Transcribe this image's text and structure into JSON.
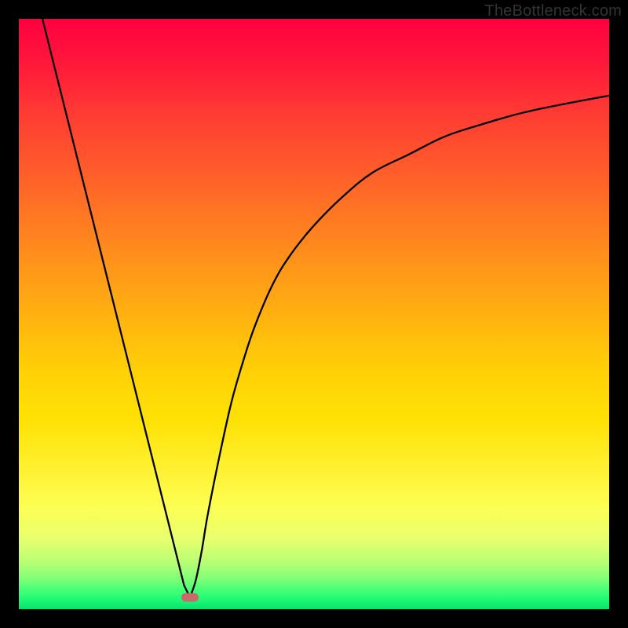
{
  "watermark": "TheBottleneck.com",
  "chart_data": {
    "type": "line",
    "title": "",
    "xlabel": "",
    "ylabel": "",
    "xlim": [
      0,
      100
    ],
    "ylim": [
      0,
      100
    ],
    "min_point": {
      "x": 29,
      "y": 2
    },
    "series": [
      {
        "name": "left-branch",
        "x": [
          4,
          6,
          8,
          10,
          12,
          14,
          16,
          18,
          20,
          22,
          24,
          26,
          27,
          28,
          29
        ],
        "y": [
          100,
          92,
          84,
          76,
          68,
          60,
          52,
          44,
          36,
          28,
          20,
          12,
          8,
          4,
          2
        ]
      },
      {
        "name": "right-branch",
        "x": [
          29,
          30,
          31,
          32,
          34,
          36,
          38,
          40,
          43,
          46,
          50,
          55,
          60,
          66,
          72,
          78,
          85,
          92,
          100
        ],
        "y": [
          2,
          5,
          10,
          16,
          26,
          35,
          42,
          48,
          55,
          60,
          65,
          70,
          74,
          77,
          80,
          82,
          84,
          85.5,
          87
        ]
      }
    ],
    "marker": {
      "x": 29,
      "y": 2,
      "color": "#c76a6a"
    }
  }
}
